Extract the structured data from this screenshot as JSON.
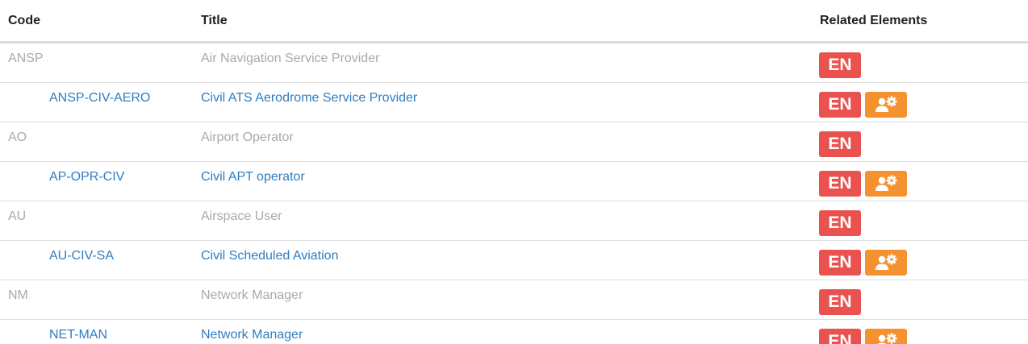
{
  "header": {
    "code": "Code",
    "title": "Title",
    "related": "Related Elements"
  },
  "badges": {
    "en_label": "EN",
    "en_color": "#e9524f",
    "role_color": "#f5922f",
    "role_icon": "user-gear-icon"
  },
  "rows": [
    {
      "code": "ANSP",
      "title": "Air Navigation Service Provider",
      "level": "parent",
      "role": false
    },
    {
      "code": "ANSP-CIV-AERO",
      "title": "Civil ATS Aerodrome Service Provider",
      "level": "child",
      "role": true
    },
    {
      "code": "AO",
      "title": "Airport Operator",
      "level": "parent",
      "role": false
    },
    {
      "code": "AP-OPR-CIV",
      "title": "Civil APT operator",
      "level": "child",
      "role": true
    },
    {
      "code": "AU",
      "title": "Airspace User",
      "level": "parent",
      "role": false
    },
    {
      "code": "AU-CIV-SA",
      "title": "Civil Scheduled Aviation",
      "level": "child",
      "role": true
    },
    {
      "code": "NM",
      "title": "Network Manager",
      "level": "parent",
      "role": false
    },
    {
      "code": "NET-MAN",
      "title": "Network Manager",
      "level": "child",
      "role": true
    }
  ]
}
